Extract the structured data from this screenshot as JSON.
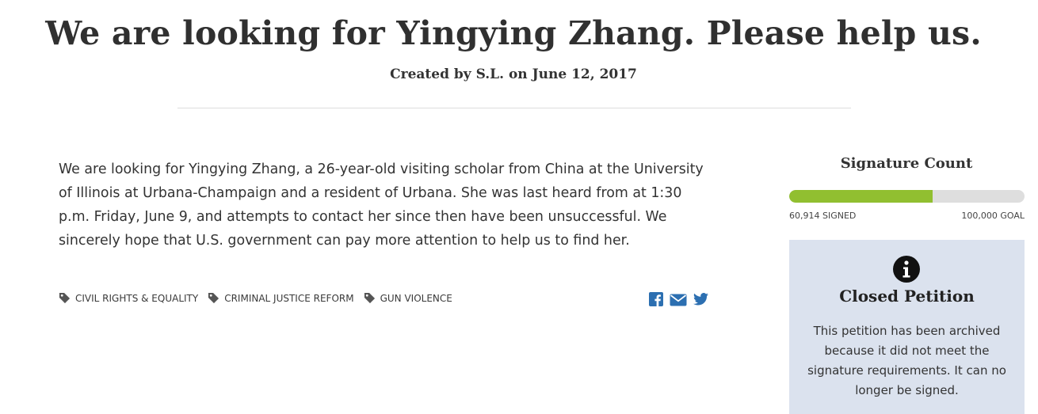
{
  "petition": {
    "title": "We are looking for Yingying Zhang. Please help us.",
    "byline": "Created by S.L. on June 12, 2017",
    "body": "We are looking for Yingying Zhang, a 26-year-old visiting scholar from China at the University of Illinois at Urbana-Champaign and a resident of Urbana. She was last heard from at 1:30 p.m. Friday, June 9, and attempts to contact her since then have been unsuccessful. We sincerely hope that U.S. government can pay more attention to help us to find her.",
    "tags": [
      {
        "label": "CIVIL RIGHTS & EQUALITY",
        "icon": "tag-icon"
      },
      {
        "label": "CRIMINAL JUSTICE REFORM",
        "icon": "tag-icon"
      },
      {
        "label": "GUN VIOLENCE",
        "icon": "tag-icon"
      }
    ],
    "share": [
      {
        "icon": "facebook-icon",
        "color": "#2c6fb1"
      },
      {
        "icon": "email-icon",
        "color": "#2c6fb1"
      },
      {
        "icon": "twitter-icon",
        "color": "#2c6fb1"
      }
    ]
  },
  "signatures": {
    "title": "Signature Count",
    "signed_label": "60,914 SIGNED",
    "goal_label": "100,000 GOAL",
    "signed": 60914,
    "goal": 100000,
    "bar_color": "#91bf30",
    "track_color": "#dedede"
  },
  "status": {
    "icon": "info-icon",
    "title": "Closed Petition",
    "message": "This petition has been archived because it did not meet the signature requirements. It can no longer be signed.",
    "background": "#dbe2ee"
  }
}
